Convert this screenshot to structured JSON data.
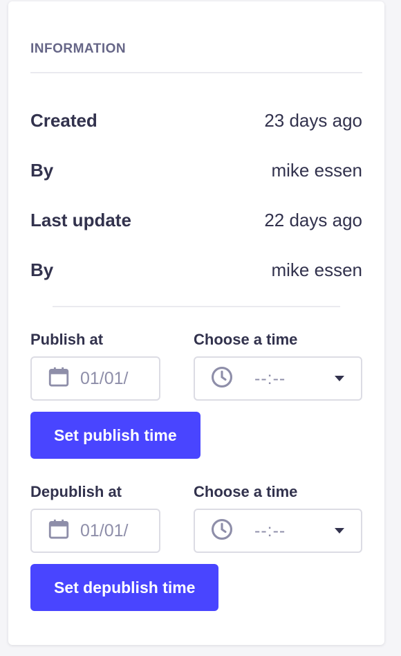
{
  "panel": {
    "title": "INFORMATION",
    "rows": [
      {
        "label": "Created",
        "value": "23 days ago"
      },
      {
        "label": "By",
        "value": "mike essen"
      },
      {
        "label": "Last update",
        "value": "22 days ago"
      },
      {
        "label": "By",
        "value": "mike essen"
      }
    ]
  },
  "publish": {
    "date_label": "Publish at",
    "time_label": "Choose a time",
    "date_value": "01/01/",
    "time_value": "--:--",
    "button_label": "Set publish time"
  },
  "depublish": {
    "date_label": "Depublish at",
    "time_label": "Choose a time",
    "date_value": "01/01/",
    "time_value": "--:--",
    "button_label": "Set depublish time"
  },
  "colors": {
    "primary": "#4945ff",
    "text": "#32324d",
    "muted": "#666687",
    "placeholder": "#8e8ea9",
    "border": "#dcdce4"
  },
  "icons": {
    "date": "calendar-icon",
    "time": "clock-icon",
    "dropdown": "caret-down-icon"
  }
}
